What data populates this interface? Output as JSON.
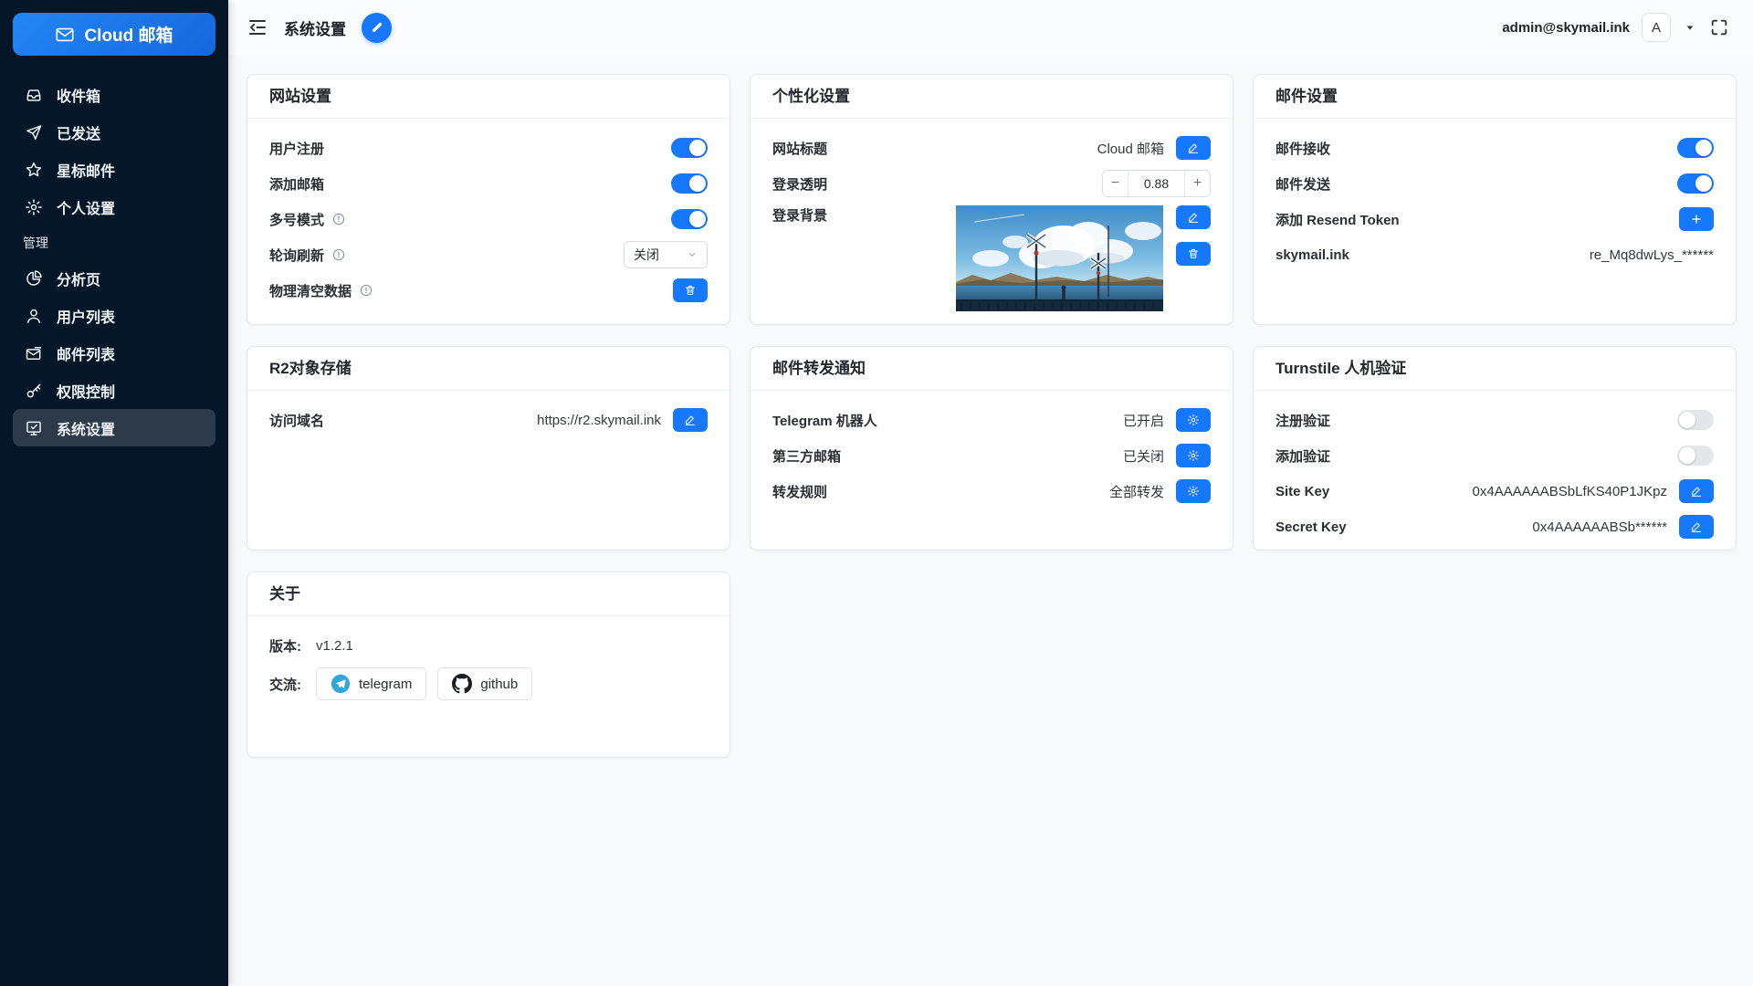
{
  "app": {
    "logo_label": "Cloud 邮箱",
    "logo_icon": "mail-icon"
  },
  "colors": {
    "primary": "#1677ff",
    "sidebar_bg": "#041627",
    "active_item_bg": "#2c3a49",
    "page_bg": "#f7f9fb",
    "toggle_off": "#e4e6e9"
  },
  "sidebar": {
    "items": [
      {
        "id": "inbox",
        "icon": "inbox-icon",
        "label": "收件箱"
      },
      {
        "id": "sent",
        "icon": "send-icon",
        "label": "已发送"
      },
      {
        "id": "starred",
        "icon": "star-icon",
        "label": "星标邮件"
      },
      {
        "id": "personal-settings",
        "icon": "gear-icon",
        "label": "个人设置"
      },
      {
        "id": "admin-section",
        "section": true,
        "label": "管理"
      },
      {
        "id": "analytics",
        "icon": "pie-chart-icon",
        "label": "分析页"
      },
      {
        "id": "user-list",
        "icon": "user-icon",
        "label": "用户列表"
      },
      {
        "id": "mail-list",
        "icon": "envelope-icon",
        "label": "邮件列表"
      },
      {
        "id": "permissions",
        "icon": "key-icon",
        "label": "权限控制"
      },
      {
        "id": "system-settings",
        "icon": "monitor-check-icon",
        "label": "系统设置",
        "active": true
      }
    ]
  },
  "header": {
    "fold_icon": "menu-fold-icon",
    "title": "系统设置",
    "edit_icon": "pencil-icon",
    "email": "admin@skymail.ink",
    "avatar_letter": "A",
    "caret_icon": "caret-down-icon",
    "fullscreen_icon": "fullscreen-icon"
  },
  "cards": [
    {
      "id": "site-settings",
      "title": "网站设置",
      "rows": [
        {
          "id": "user-register",
          "label": "用户注册",
          "control": "toggle",
          "on": true
        },
        {
          "id": "add-mailbox",
          "label": "添加邮箱",
          "control": "toggle",
          "on": true
        },
        {
          "id": "multi-account-mode",
          "label": "多号模式",
          "info": true,
          "control": "toggle",
          "on": true
        },
        {
          "id": "polling-refresh",
          "label": "轮询刷新",
          "info": true,
          "control": "select",
          "value": "关闭"
        },
        {
          "id": "purge-data",
          "label": "物理清空数据",
          "info": true,
          "control": "button",
          "icon": "trash-icon"
        }
      ]
    },
    {
      "id": "personalization",
      "title": "个性化设置",
      "rows": [
        {
          "id": "site-title",
          "label": "网站标题",
          "control": "text-edit",
          "value": "Cloud 邮箱",
          "icon": "edit-pencil-icon"
        },
        {
          "id": "login-opacity",
          "label": "登录透明",
          "control": "stepper",
          "value": "0.88"
        },
        {
          "id": "login-background",
          "label": "登录背景",
          "control": "image",
          "image": "login-background-thumbnail",
          "buttons": [
            "edit-pencil-icon",
            "trash-icon"
          ]
        }
      ]
    },
    {
      "id": "mail-settings",
      "title": "邮件设置",
      "rows": [
        {
          "id": "mail-receive",
          "label": "邮件接收",
          "control": "toggle",
          "on": true
        },
        {
          "id": "mail-send",
          "label": "邮件发送",
          "control": "toggle",
          "on": true
        },
        {
          "id": "add-resend-token",
          "label": "添加 Resend Token",
          "control": "button",
          "icon": "plus-icon"
        },
        {
          "id": "resend-token-skymail",
          "label": "skymail.ink",
          "control": "text",
          "value": "re_Mq8dwLys_******"
        }
      ]
    },
    {
      "id": "r2-storage",
      "title": "R2对象存储",
      "rows": [
        {
          "id": "access-domain",
          "label": "访问域名",
          "control": "text-edit",
          "value": "https://r2.skymail.ink",
          "icon": "edit-pencil-icon"
        }
      ]
    },
    {
      "id": "forward-notify",
      "title": "邮件转发通知",
      "rows": [
        {
          "id": "telegram-bot",
          "label": "Telegram 机器人",
          "control": "text-gear",
          "value": "已开启",
          "icon": "gear-icon"
        },
        {
          "id": "third-party-mailbox",
          "label": "第三方邮箱",
          "control": "text-gear",
          "value": "已关闭",
          "icon": "gear-icon"
        },
        {
          "id": "forward-rule",
          "label": "转发规则",
          "control": "text-gear",
          "value": "全部转发",
          "icon": "gear-icon"
        }
      ]
    },
    {
      "id": "turnstile",
      "title": "Turnstile 人机验证",
      "rows": [
        {
          "id": "register-captcha",
          "label": "注册验证",
          "control": "toggle",
          "on": false
        },
        {
          "id": "add-captcha",
          "label": "添加验证",
          "control": "toggle",
          "on": false
        },
        {
          "id": "site-key",
          "label": "Site Key",
          "control": "text-edit",
          "value": "0x4AAAAAABSbLfKS40P1JKpz",
          "icon": "edit-pencil-icon"
        },
        {
          "id": "secret-key",
          "label": "Secret Key",
          "control": "text-edit",
          "value": "0x4AAAAAABSb******",
          "icon": "edit-pencil-icon"
        }
      ]
    },
    {
      "id": "about",
      "title": "关于",
      "rows": [
        {
          "id": "version",
          "label": "版本:",
          "control": "text-inline",
          "value": "v1.2.1"
        },
        {
          "id": "community",
          "label": "交流:",
          "control": "links",
          "links": [
            {
              "id": "telegram",
              "icon": "telegram-icon",
              "label": "telegram"
            },
            {
              "id": "github",
              "icon": "github-icon",
              "label": "github"
            }
          ]
        }
      ]
    }
  ]
}
